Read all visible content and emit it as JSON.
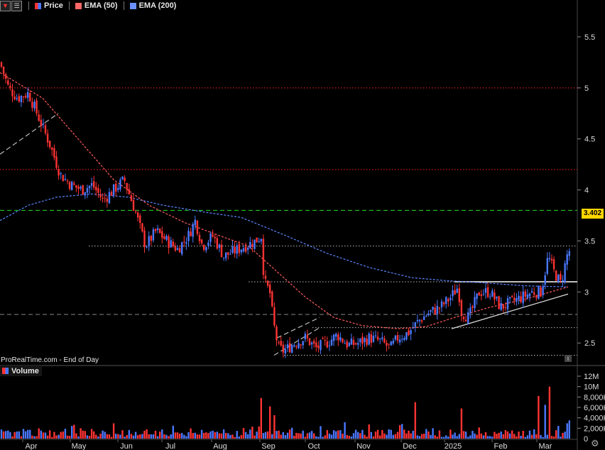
{
  "legend": {
    "price_label": "Price",
    "ema50_label": "EMA (50)",
    "ema200_label": "EMA (200)",
    "ema50_color": "#ff4444",
    "ema200_color": "#4a78ff"
  },
  "volume_legend": {
    "label": "Volume"
  },
  "footer": {
    "source": "ProRealTime.com - End of Day"
  },
  "last_price": "3.402",
  "colors": {
    "up": "#4a78ff",
    "down": "#ff3333",
    "background": "#000000"
  },
  "chart_data": [
    {
      "type": "candlestick",
      "title": "",
      "x": [
        "Apr",
        "May",
        "Jun",
        "Jul",
        "Aug",
        "Sep",
        "Oct",
        "Nov",
        "Dec",
        "2025",
        "Feb",
        "Mar"
      ],
      "yticks": [
        2.5,
        3,
        3.5,
        4,
        4.5,
        5,
        5.5
      ],
      "ylim": [
        2.3,
        5.75
      ],
      "price_path": [
        [
          0,
          5.25
        ],
        [
          12,
          5.0
        ],
        [
          25,
          4.9
        ],
        [
          40,
          4.95
        ],
        [
          55,
          4.7
        ],
        [
          70,
          4.45
        ],
        [
          85,
          4.15
        ],
        [
          100,
          4.05
        ],
        [
          115,
          4.0
        ],
        [
          130,
          4.05
        ],
        [
          145,
          3.9
        ],
        [
          160,
          4.0
        ],
        [
          175,
          4.1
        ],
        [
          190,
          3.8
        ],
        [
          205,
          3.45
        ],
        [
          220,
          3.6
        ],
        [
          235,
          3.5
        ],
        [
          250,
          3.42
        ],
        [
          265,
          3.55
        ],
        [
          275,
          3.7
        ],
        [
          285,
          3.45
        ],
        [
          300,
          3.55
        ],
        [
          315,
          3.35
        ],
        [
          330,
          3.4
        ],
        [
          345,
          3.45
        ],
        [
          360,
          3.5
        ],
        [
          368,
          3.55
        ],
        [
          372,
          3.1
        ],
        [
          380,
          3.0
        ],
        [
          385,
          2.7
        ],
        [
          392,
          2.45
        ],
        [
          400,
          2.42
        ],
        [
          415,
          2.5
        ],
        [
          430,
          2.55
        ],
        [
          445,
          2.45
        ],
        [
          460,
          2.5
        ],
        [
          475,
          2.58
        ],
        [
          490,
          2.48
        ],
        [
          505,
          2.5
        ],
        [
          520,
          2.55
        ],
        [
          535,
          2.52
        ],
        [
          550,
          2.45
        ],
        [
          560,
          2.55
        ],
        [
          575,
          2.6
        ],
        [
          590,
          2.72
        ],
        [
          605,
          2.8
        ],
        [
          620,
          2.85
        ],
        [
          635,
          2.95
        ],
        [
          645,
          3.05
        ],
        [
          650,
          2.8
        ],
        [
          660,
          2.75
        ],
        [
          675,
          3.0
        ],
        [
          690,
          3.0
        ],
        [
          705,
          2.85
        ],
        [
          720,
          2.9
        ],
        [
          735,
          2.95
        ],
        [
          750,
          3.0
        ],
        [
          762,
          3.0
        ],
        [
          772,
          3.35
        ],
        [
          780,
          3.2
        ],
        [
          790,
          3.08
        ],
        [
          800,
          3.402
        ]
      ],
      "ema50_path": [
        [
          0,
          5.15
        ],
        [
          60,
          4.9
        ],
        [
          110,
          4.5
        ],
        [
          160,
          4.1
        ],
        [
          210,
          3.85
        ],
        [
          260,
          3.68
        ],
        [
          310,
          3.55
        ],
        [
          350,
          3.45
        ],
        [
          390,
          3.2
        ],
        [
          430,
          2.95
        ],
        [
          470,
          2.75
        ],
        [
          510,
          2.67
        ],
        [
          560,
          2.64
        ],
        [
          600,
          2.66
        ],
        [
          640,
          2.75
        ],
        [
          690,
          2.85
        ],
        [
          740,
          2.93
        ],
        [
          800,
          3.05
        ]
      ],
      "ema200_path": [
        [
          0,
          3.7
        ],
        [
          40,
          3.85
        ],
        [
          80,
          3.93
        ],
        [
          130,
          3.96
        ],
        [
          180,
          3.93
        ],
        [
          230,
          3.85
        ],
        [
          290,
          3.78
        ],
        [
          340,
          3.73
        ],
        [
          400,
          3.56
        ],
        [
          460,
          3.38
        ],
        [
          520,
          3.24
        ],
        [
          580,
          3.14
        ],
        [
          630,
          3.11
        ],
        [
          680,
          3.09
        ],
        [
          740,
          3.06
        ],
        [
          800,
          3.05
        ]
      ],
      "horizontal_levels": [
        {
          "value": 5.0,
          "style": "dotted",
          "color": "#ff2222"
        },
        {
          "value": 4.2,
          "style": "dotted",
          "color": "#ff2222"
        },
        {
          "value": 3.8,
          "style": "dashed",
          "color": "#22dd22"
        },
        {
          "value": 3.45,
          "style": "dotted",
          "color": "#bbbbbb",
          "from_x": 125
        },
        {
          "value": 3.1,
          "style": "dotted",
          "color": "#bbbbbb",
          "from_x": 350
        },
        {
          "value": 3.1,
          "style": "solid",
          "color": "#ffffff",
          "from_x": 640
        },
        {
          "value": 2.78,
          "style": "dashed",
          "color": "#888888"
        },
        {
          "value": 2.65,
          "style": "dotted",
          "color": "#bbbbbb",
          "from_x": 440
        },
        {
          "value": 2.38,
          "style": "dotted",
          "color": "#bbbbbb",
          "from_x": 400
        }
      ],
      "trendlines": [
        {
          "p1": [
            0,
            4.35
          ],
          "p2": [
            82,
            4.75
          ],
          "style": "dashed",
          "color": "#bbbbbb"
        },
        {
          "p1": [
            386,
            2.38
          ],
          "p2": [
            450,
            2.65
          ],
          "style": "dashed",
          "color": "#bbbbbb"
        },
        {
          "p1": [
            390,
            2.55
          ],
          "p2": [
            450,
            2.75
          ],
          "style": "dashed",
          "color": "#bbbbbb"
        },
        {
          "p1": [
            636,
            2.64
          ],
          "p2": [
            800,
            2.98
          ],
          "style": "solid",
          "color": "#dddddd"
        }
      ]
    },
    {
      "type": "bar",
      "title": "Volume",
      "yticks": [
        "12M",
        "10M",
        "8,000K",
        "6,000K",
        "4,000K",
        "2,000K",
        "0"
      ],
      "ytick_values": [
        12000,
        10000,
        8000,
        6000,
        4000,
        2000,
        0
      ],
      "ylim": [
        0,
        12000
      ],
      "units": "thousands",
      "spikes": [
        [
          367,
          7800,
          "down"
        ],
        [
          378,
          6200,
          "down"
        ],
        [
          385,
          4500,
          "down"
        ],
        [
          583,
          7000,
          "down"
        ],
        [
          648,
          5800,
          "down"
        ],
        [
          755,
          8200,
          "down"
        ],
        [
          765,
          6500,
          "up"
        ],
        [
          772,
          10000,
          "down"
        ],
        [
          799,
          3500,
          "up"
        ]
      ]
    }
  ]
}
